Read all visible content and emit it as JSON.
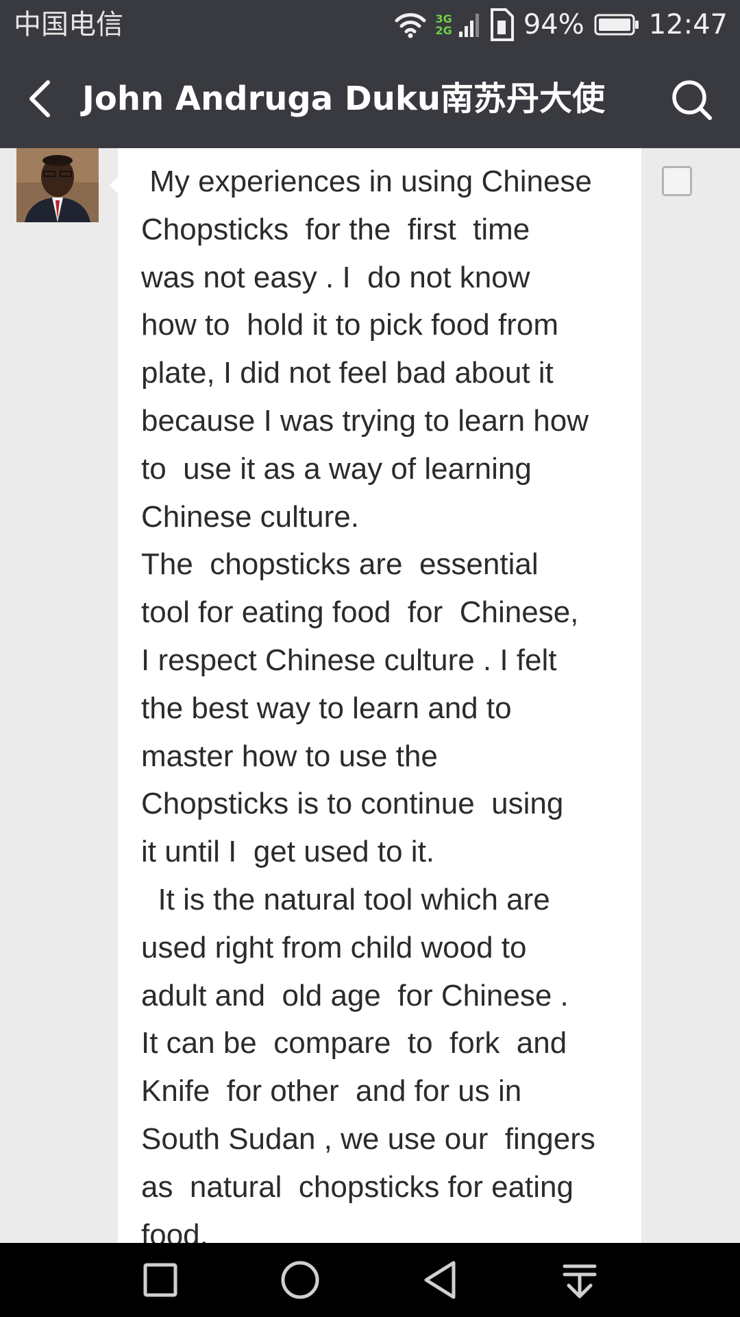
{
  "status_bar": {
    "carrier": "中国电信",
    "network_top": "3G",
    "network_bottom": "2G",
    "battery_percent": "94%",
    "time": "12:47",
    "icons": [
      "wifi-icon",
      "signal-icon",
      "sim-icon",
      "battery-icon"
    ]
  },
  "header": {
    "title": "John Andruga Duku南苏丹大使",
    "back_icon": "chevron-left-icon",
    "search_icon": "search-icon"
  },
  "message": {
    "lines": [
      " My experiences in using Chinese",
      "Chopsticks  for the  first  time",
      "was not easy . I  do not know",
      "how to  hold it to pick food from",
      "plate, I did not feel bad about it",
      "because I was trying to learn how",
      "to  use it as a way of learning",
      "Chinese culture.",
      "The  chopsticks are  essential",
      "tool for eating food  for  Chinese,",
      "I respect Chinese culture . I felt",
      "the best way to learn and to",
      "master how to use the",
      "Chopsticks is to continue  using",
      "it until I  get used to it.",
      "  It is the natural tool which are",
      "used right from child wood to",
      "adult and  old age  for Chinese .",
      "It can be  compare  to  fork  and",
      "Knife  for other  and for us in",
      "South Sudan , we use our  fingers",
      "as  natural  chopsticks for eating",
      "food."
    ]
  },
  "nav_bar": {
    "icons": [
      "recent-apps-icon",
      "home-icon",
      "back-icon",
      "notification-pull-down-icon"
    ]
  },
  "colors": {
    "header_bg": "#393a3f",
    "content_bg": "#ebebeb",
    "bubble_bg": "#ffffff",
    "text": "#2b2b2b",
    "network_badge": "#6fcf4a",
    "nav_bg": "#000000"
  }
}
